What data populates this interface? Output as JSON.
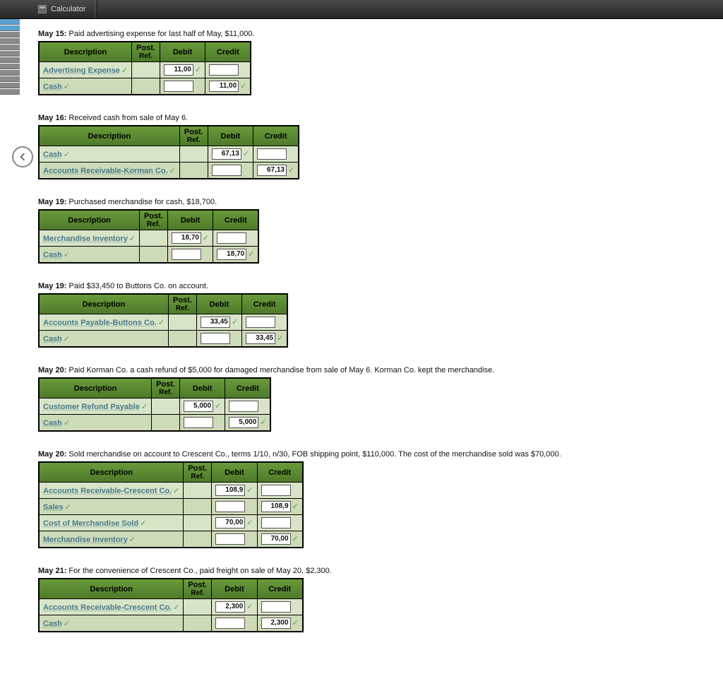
{
  "topbar": {
    "calculator": "Calculator"
  },
  "header": {
    "desc": "Description",
    "post": "Post.",
    "ref": "Ref.",
    "debit": "Debit",
    "credit": "Credit"
  },
  "entries": [
    {
      "date": "May 15:",
      "text": " Paid advertising expense for last half of May, $11,000.",
      "rows": [
        {
          "acct": "Advertising Expense",
          "debit": "11,00",
          "credit": ""
        },
        {
          "acct": "Cash",
          "debit": "",
          "credit": "11,00"
        }
      ]
    },
    {
      "date": "May 16:",
      "text": " Received cash from sale of May 6.",
      "rows": [
        {
          "acct": "Cash",
          "debit": "67,13",
          "credit": ""
        },
        {
          "acct": "Accounts Receivable-Korman Co.",
          "debit": "",
          "credit": "67,13"
        }
      ]
    },
    {
      "date": "May 19:",
      "text": " Purchased merchandise for cash, $18,700.",
      "rows": [
        {
          "acct": "Merchandise Inventory",
          "debit": "18,70",
          "credit": ""
        },
        {
          "acct": "Cash",
          "debit": "",
          "credit": "18,70"
        }
      ]
    },
    {
      "date": "May 19:",
      "text": " Paid $33,450 to Buttons Co. on account.",
      "rows": [
        {
          "acct": "Accounts Payable-Buttons Co.",
          "debit": "33,45",
          "credit": ""
        },
        {
          "acct": "Cash",
          "debit": "",
          "credit": "33,45"
        }
      ]
    },
    {
      "date": "May 20:",
      "text": " Paid Korman Co. a cash refund of $5,000 for damaged merchandise from sale of May 6. Korman Co. kept the merchandise.",
      "rows": [
        {
          "acct": "Customer Refund Payable",
          "debit": "5,000",
          "credit": ""
        },
        {
          "acct": "Cash",
          "debit": "",
          "credit": "5,000"
        }
      ]
    },
    {
      "date": "May 20:",
      "text": " Sold merchandise on account to Crescent Co., terms 1/10, n/30, FOB shipping point, $110,000. The cost of the merchandise sold was $70,000.",
      "rows": [
        {
          "acct": "Accounts Receivable-Crescent Co.",
          "debit": "108,9",
          "credit": ""
        },
        {
          "acct": "Sales",
          "debit": "",
          "credit": "108,9"
        },
        {
          "acct": "Cost of Merchandise Sold",
          "debit": "70,00",
          "credit": ""
        },
        {
          "acct": "Merchandise Inventory",
          "debit": "",
          "credit": "70,00"
        }
      ]
    },
    {
      "date": "May 21:",
      "text": " For the convenience of Crescent Co., paid freight on sale of May 20, $2,300.",
      "rows": [
        {
          "acct": "Accounts Receivable-Crescent Co.",
          "debit": "2,300",
          "credit": ""
        },
        {
          "acct": "Cash",
          "debit": "",
          "credit": "2,300"
        }
      ]
    }
  ]
}
